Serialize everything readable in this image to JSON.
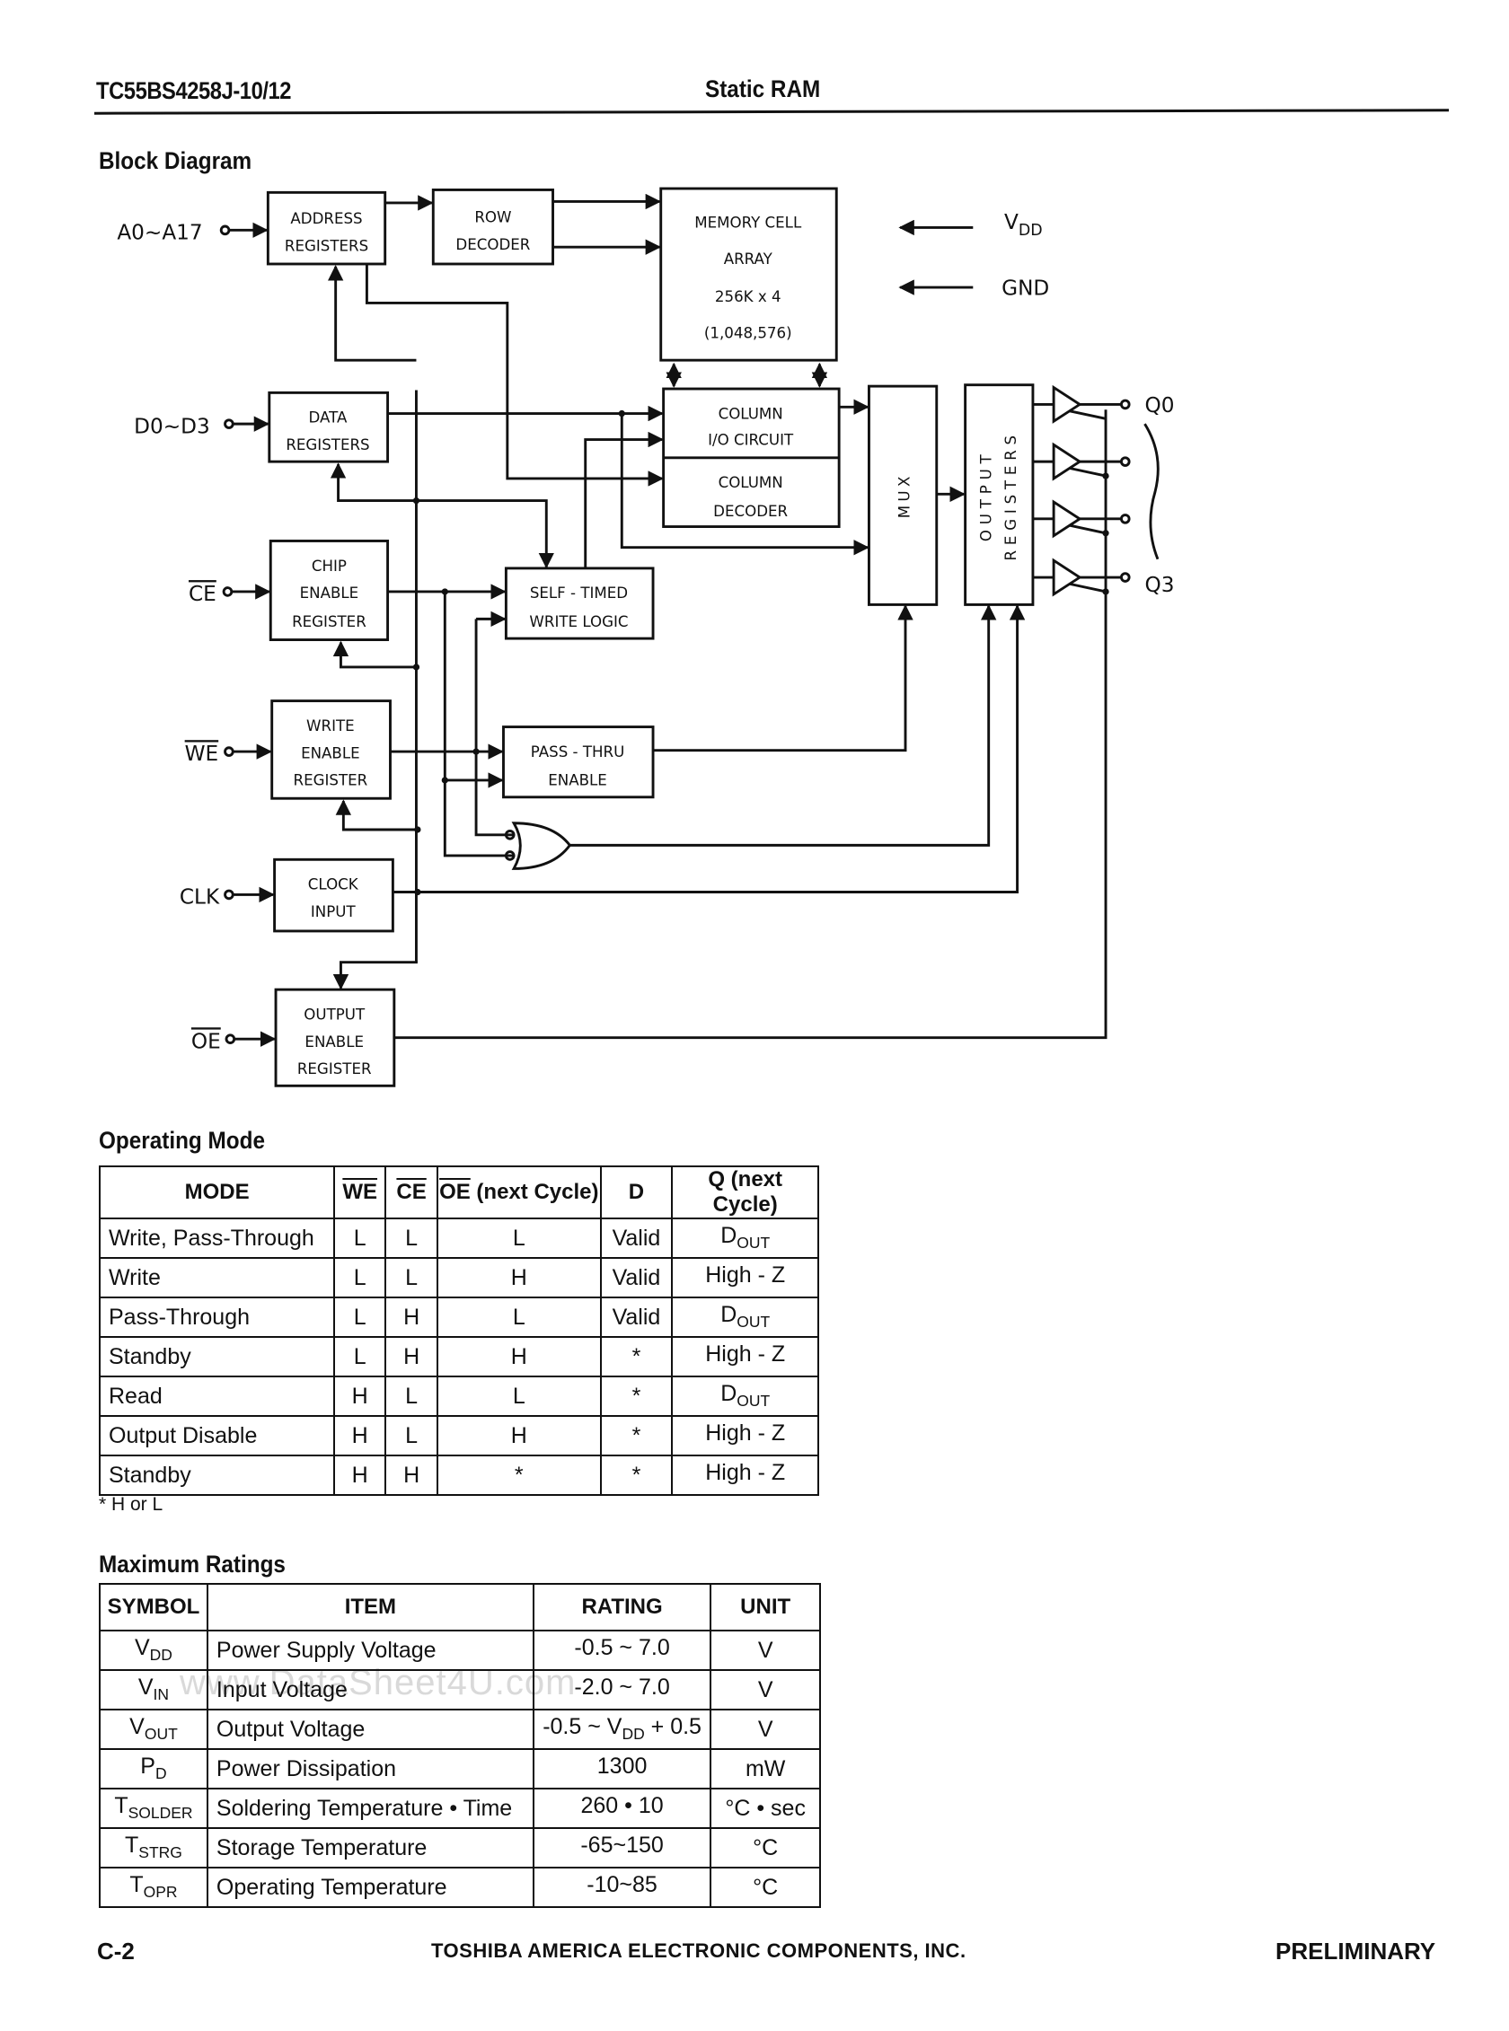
{
  "header": {
    "part_number": "TC55BS4258J-10/12",
    "product_type": "Static RAM"
  },
  "block_diagram": {
    "title": "Block Diagram",
    "pins": {
      "address": "A0~A17",
      "data": "D0~D3",
      "chip_enable": "CE",
      "write_enable": "WE",
      "clock": "CLK",
      "output_enable": "OE",
      "q0": "Q0",
      "q3": "Q3",
      "vdd_main": "V",
      "vdd_sub": "DD",
      "gnd": "GND"
    },
    "blocks": {
      "address_registers": [
        "ADDRESS",
        "REGISTERS"
      ],
      "row_decoder": [
        "ROW",
        "DECODER"
      ],
      "memory_cell_array": [
        "MEMORY CELL",
        "ARRAY",
        "256K x 4",
        "(1,048,576)"
      ],
      "data_registers": [
        "DATA",
        "REGISTERS"
      ],
      "column_io_circuit": [
        "COLUMN",
        "I/O CIRCUIT"
      ],
      "column_decoder": [
        "COLUMN",
        "DECODER"
      ],
      "mux": "MUX",
      "output_registers": [
        "OUTPUT",
        "REGISTERS"
      ],
      "chip_enable_register": [
        "CHIP",
        "ENABLE",
        "REGISTER"
      ],
      "self_timed_write_logic": [
        "SELF - TIMED",
        "WRITE LOGIC"
      ],
      "write_enable_register": [
        "WRITE",
        "ENABLE",
        "REGISTER"
      ],
      "pass_thru_enable": [
        "PASS - THRU",
        "ENABLE"
      ],
      "clock_input": [
        "CLOCK",
        "INPUT"
      ],
      "output_enable_register": [
        "OUTPUT",
        "ENABLE",
        "REGISTER"
      ]
    }
  },
  "operating_mode": {
    "title": "Operating Mode",
    "columns": {
      "mode": "MODE",
      "we": "WE",
      "ce": "CE",
      "oe": "OE",
      "oe_suffix": " (next Cycle)",
      "d": "D",
      "q": "Q (next Cycle)"
    },
    "rows": [
      {
        "mode": "Write, Pass-Through",
        "we": "L",
        "ce": "L",
        "oe": "L",
        "d": "Valid",
        "q_main": "D",
        "q_sub": "OUT"
      },
      {
        "mode": "Write",
        "we": "L",
        "ce": "L",
        "oe": "H",
        "d": "Valid",
        "q_main": "High - Z",
        "q_sub": ""
      },
      {
        "mode": "Pass-Through",
        "we": "L",
        "ce": "H",
        "oe": "L",
        "d": "Valid",
        "q_main": "D",
        "q_sub": "OUT"
      },
      {
        "mode": "Standby",
        "we": "L",
        "ce": "H",
        "oe": "H",
        "d": "*",
        "q_main": "High - Z",
        "q_sub": ""
      },
      {
        "mode": "Read",
        "we": "H",
        "ce": "L",
        "oe": "L",
        "d": "*",
        "q_main": "D",
        "q_sub": "OUT"
      },
      {
        "mode": "Output Disable",
        "we": "H",
        "ce": "L",
        "oe": "H",
        "d": "*",
        "q_main": "High - Z",
        "q_sub": ""
      },
      {
        "mode": "Standby",
        "we": "H",
        "ce": "H",
        "oe": "*",
        "d": "*",
        "q_main": "High - Z",
        "q_sub": ""
      }
    ],
    "footnote": "* H or L"
  },
  "maximum_ratings": {
    "title": "Maximum Ratings",
    "columns": {
      "symbol": "SYMBOL",
      "item": "ITEM",
      "rating": "RATING",
      "unit": "UNIT"
    },
    "rows": [
      {
        "sym": "V",
        "sym_sub": "DD",
        "item": "Power Supply Voltage",
        "rating": "-0.5 ~ 7.0",
        "rating_sub": "",
        "rating_tail": "",
        "unit": "V"
      },
      {
        "sym": "V",
        "sym_sub": "IN",
        "item": "Input Voltage",
        "rating": "-2.0 ~ 7.0",
        "rating_sub": "",
        "rating_tail": "",
        "unit": "V"
      },
      {
        "sym": "V",
        "sym_sub": "OUT",
        "item": "Output Voltage",
        "rating": "-0.5 ~ V",
        "rating_sub": "DD",
        "rating_tail": " + 0.5",
        "unit": "V"
      },
      {
        "sym": "P",
        "sym_sub": "D",
        "item": "Power Dissipation",
        "rating": "1300",
        "rating_sub": "",
        "rating_tail": "",
        "unit": "mW"
      },
      {
        "sym": "T",
        "sym_sub": "SOLDER",
        "item": "Soldering Temperature • Time",
        "rating": "260 • 10",
        "rating_sub": "",
        "rating_tail": "",
        "unit": "°C • sec"
      },
      {
        "sym": "T",
        "sym_sub": "STRG",
        "item": "Storage Temperature",
        "rating": "-65~150",
        "rating_sub": "",
        "rating_tail": "",
        "unit": "°C"
      },
      {
        "sym": "T",
        "sym_sub": "OPR",
        "item": "Operating Temperature",
        "rating": "-10~85",
        "rating_sub": "",
        "rating_tail": "",
        "unit": "°C"
      }
    ]
  },
  "watermark": "www.DataSheet4U.com",
  "footer": {
    "page": "C-2",
    "company": "TOSHIBA AMERICA ELECTRONIC COMPONENTS, INC.",
    "status": "PRELIMINARY"
  }
}
